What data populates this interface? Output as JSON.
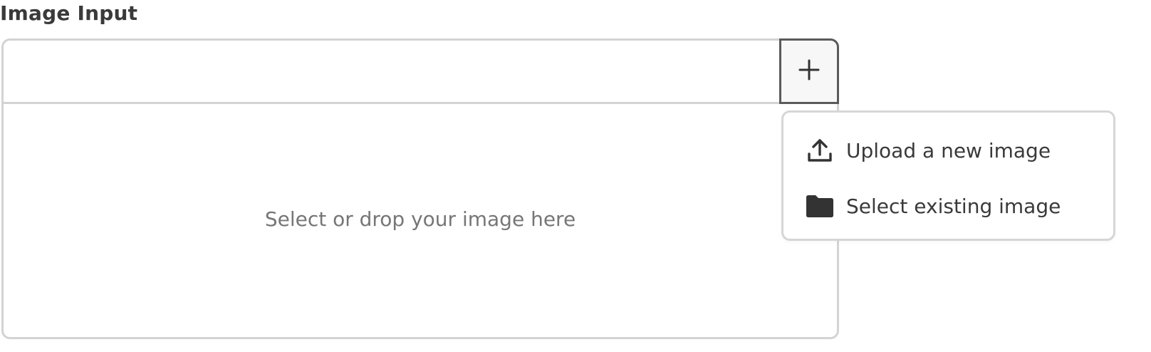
{
  "field": {
    "label": "Image Input"
  },
  "dropzone": {
    "text": "Select or drop your image here"
  },
  "add_button": {
    "icon": "plus-icon"
  },
  "menu": {
    "items": [
      {
        "label": "Upload a new image",
        "icon": "upload-icon"
      },
      {
        "label": "Select existing image",
        "icon": "folder-icon"
      }
    ]
  },
  "colors": {
    "border": "#d3d3d3",
    "button_border": "#5a5a5a",
    "text": "#3a3a3a",
    "muted_text": "#767676"
  }
}
